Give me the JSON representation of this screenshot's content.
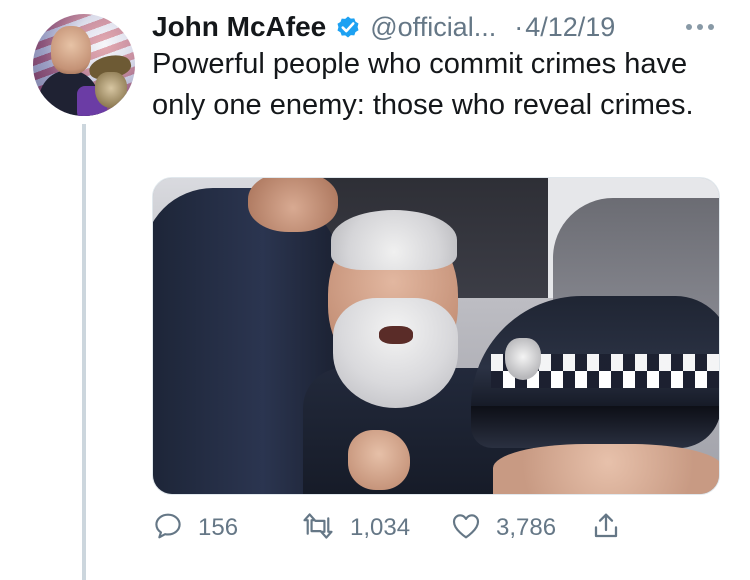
{
  "tweet": {
    "author_name": "John McAfee",
    "handle": "@official...",
    "separator": "·",
    "date": "4/12/19",
    "verified": true,
    "text": "Powerful people who commit crimes have only one enemy: those who reveal crimes.",
    "icons": {
      "verified": "verified-badge-icon",
      "more": "more-dots-icon",
      "reply": "reply-bubble-icon",
      "retweet": "retweet-icon",
      "like": "heart-icon",
      "share": "share-icon"
    },
    "colors": {
      "verified": "#1da1f2",
      "muted": "#657786",
      "text": "#14171a"
    },
    "stats": {
      "replies": "156",
      "retweets": "1,034",
      "likes": "3,786"
    }
  }
}
